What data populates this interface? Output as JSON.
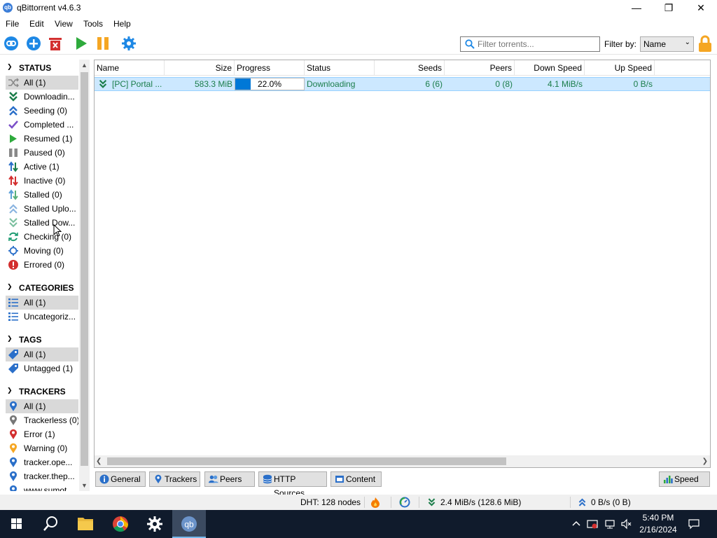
{
  "window": {
    "title": "qBittorrent v4.6.3",
    "app_icon_text": "qb",
    "minimize": "—",
    "maximize": "❐",
    "close": "✕"
  },
  "menu": [
    "File",
    "Edit",
    "View",
    "Tools",
    "Help"
  ],
  "toolbar": {
    "search_placeholder": "Filter torrents...",
    "filter_by_label": "Filter by:",
    "filter_by_value": "Name"
  },
  "sidebar": {
    "status_header": "STATUS",
    "status_items": [
      {
        "label": "All (1)",
        "icon": "shuffle-icon"
      },
      {
        "label": "Downloadin...",
        "icon": "download-arrows-icon"
      },
      {
        "label": "Seeding (0)",
        "icon": "seeding-arrows-icon"
      },
      {
        "label": "Completed ...",
        "icon": "checkmark-icon"
      },
      {
        "label": "Resumed (1)",
        "icon": "play-icon"
      },
      {
        "label": "Paused (0)",
        "icon": "pause-icon"
      },
      {
        "label": "Active (1)",
        "icon": "active-arrows-icon"
      },
      {
        "label": "Inactive (0)",
        "icon": "inactive-arrows-icon"
      },
      {
        "label": "Stalled (0)",
        "icon": "stalled-arrows-icon"
      },
      {
        "label": "Stalled Uplo...",
        "icon": "stalled-upload-icon"
      },
      {
        "label": "Stalled Dow...",
        "icon": "stalled-download-icon"
      },
      {
        "label": "Checking (0)",
        "icon": "refresh-icon"
      },
      {
        "label": "Moving (0)",
        "icon": "move-icon"
      },
      {
        "label": "Errored (0)",
        "icon": "error-icon"
      }
    ],
    "categories_header": "CATEGORIES",
    "category_items": [
      {
        "label": "All (1)",
        "icon": "list-icon"
      },
      {
        "label": "Uncategoriz...",
        "icon": "list-icon"
      }
    ],
    "tags_header": "TAGS",
    "tag_items": [
      {
        "label": "All (1)",
        "icon": "tag-icon"
      },
      {
        "label": "Untagged (1)",
        "icon": "tag-icon"
      }
    ],
    "trackers_header": "TRACKERS",
    "tracker_items": [
      {
        "label": "All (1)",
        "icon": "map-pin-icon"
      },
      {
        "label": "Trackerless (0)",
        "icon": "map-pin-icon"
      },
      {
        "label": "Error (1)",
        "icon": "map-pin-icon"
      },
      {
        "label": "Warning (0)",
        "icon": "map-pin-icon"
      },
      {
        "label": "tracker.ope...",
        "icon": "map-pin-icon"
      },
      {
        "label": "tracker.thep...",
        "icon": "map-pin-icon"
      },
      {
        "label": "www.sumot...",
        "icon": "map-pin-icon"
      }
    ]
  },
  "table": {
    "columns": [
      "Name",
      "Size",
      "Progress",
      "Status",
      "Seeds",
      "Peers",
      "Down Speed",
      "Up Speed"
    ],
    "rows": [
      {
        "name": "[PC] Portal ...",
        "size": "583.3 MiB",
        "progress": "22.0%",
        "progress_value": 0.22,
        "status": "Downloading",
        "seeds": "6 (6)",
        "peers": "0 (8)",
        "down_speed": "4.1 MiB/s",
        "up_speed": "0 B/s"
      }
    ]
  },
  "tabs": {
    "general": "General",
    "trackers": "Trackers",
    "peers": "Peers",
    "http_sources": "HTTP Sources",
    "content": "Content",
    "speed": "Speed"
  },
  "statusbar": {
    "dht": "DHT: 128 nodes",
    "download": "2.4 MiB/s (128.6 MiB)",
    "upload": "0 B/s (0 B)"
  },
  "taskbar": {
    "time": "5:40 PM",
    "date": "2/16/2024"
  },
  "colors": {
    "accent": "#0078d7",
    "downloading_text": "#1b7d4a",
    "selected_row": "#cce8ff"
  }
}
